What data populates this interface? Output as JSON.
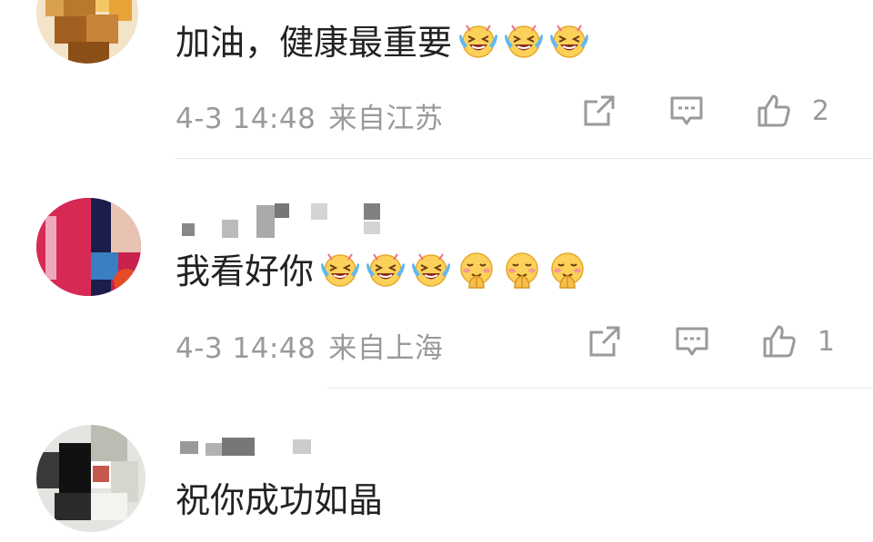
{
  "comments": [
    {
      "text": "加油，健康最重要",
      "emojis": [
        "laugh-cry-emoji",
        "laugh-cry-emoji",
        "laugh-cry-emoji"
      ],
      "time": "4-3 14:48",
      "location": "来自江苏",
      "likes": "2"
    },
    {
      "text": "我看好你",
      "emojis": [
        "laugh-cry-emoji",
        "laugh-cry-emoji",
        "laugh-cry-emoji",
        "blush-pray-emoji",
        "blush-pray-emoji",
        "blush-pray-emoji"
      ],
      "time": "4-3 14:48",
      "location": "来自上海",
      "likes": "1"
    },
    {
      "text": "祝你成功如晶"
    }
  ],
  "icons": {
    "share": "share-icon",
    "comment": "comment-icon",
    "like": "thumbs-up-icon"
  },
  "colors": {
    "text": "#222222",
    "meta": "#9a9a9a",
    "divider": "#e9e9e9"
  }
}
